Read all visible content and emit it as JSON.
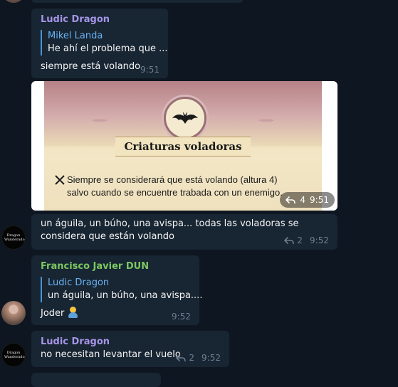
{
  "messages": [
    {
      "sender": "Ludic Dragon",
      "sender_color": "#a695e7",
      "reply": {
        "name": "Mikel Landa",
        "text": "He ahí el problema que ..."
      },
      "text": "siempre está volando",
      "time": "9:51"
    },
    {
      "image_title": "Criaturas voladoras",
      "image_text": "Siempre se considerará que está volando (altura 4) salvo cuando se encuentre trabada con un enemigo.",
      "forwards": "4",
      "time": "9:51"
    },
    {
      "text": "un águila, un búho, una avispa... todas las voladoras se considera que están volando",
      "forwards": "2",
      "time": "9:52"
    },
    {
      "sender": "Francisco Javier DUN",
      "sender_color": "#7bc862",
      "reply": {
        "name": "Ludic Dragon",
        "text": "un águila, un búho, una avispa...."
      },
      "text": "Joder",
      "emoji": "person-emoji",
      "time": "9:52"
    },
    {
      "sender": "Ludic Dragon",
      "sender_color": "#a695e7",
      "text": "no necesitan levantar el vuelo",
      "forwards": "2",
      "time": "9:52"
    }
  ],
  "avatar_watermark": "Dragon Wanderado",
  "colors": {
    "background": "#0e1621",
    "bubble": "#182533",
    "quote_bar": "#4a95d6",
    "meta": "#6d7f8f"
  },
  "icons": [
    "forward-icon",
    "bat-icon",
    "crossed-swords-icon"
  ]
}
